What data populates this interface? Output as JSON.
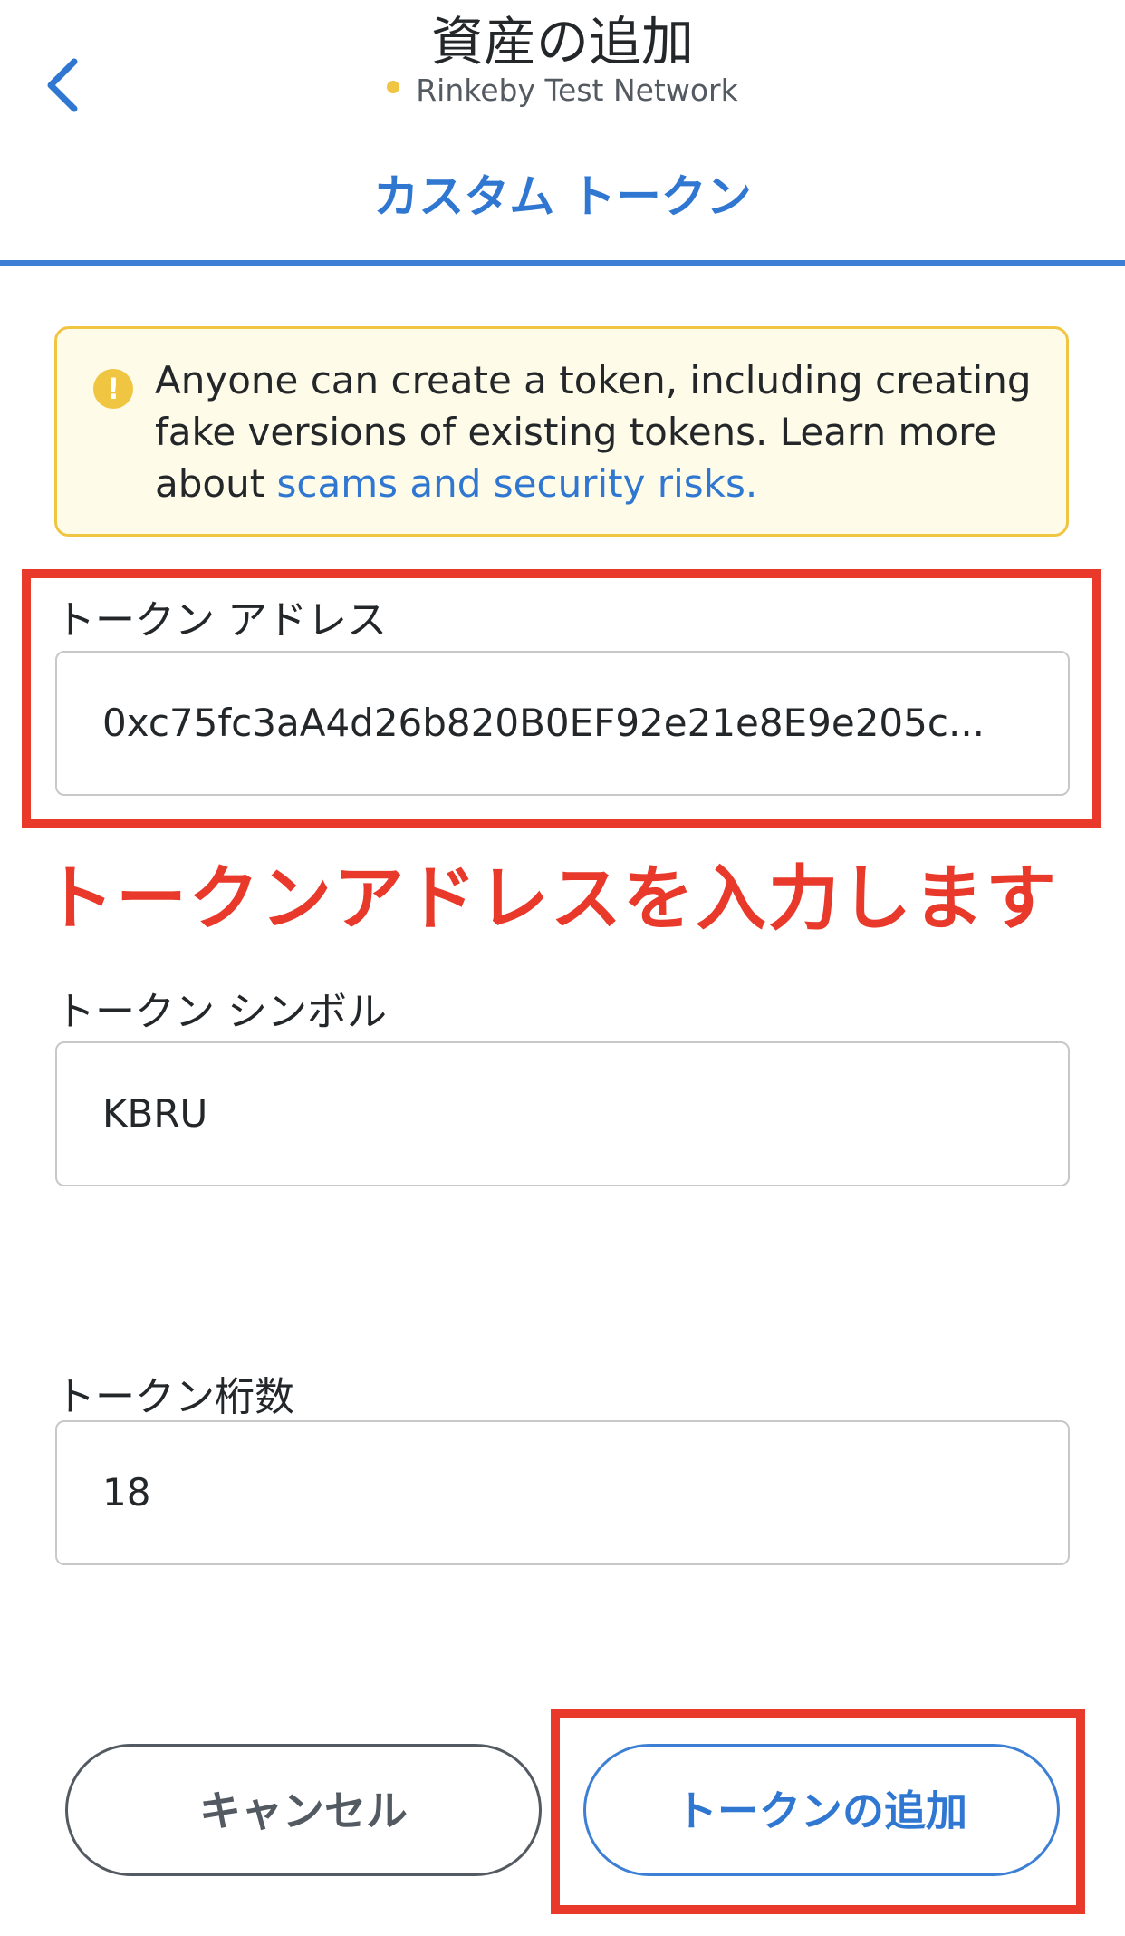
{
  "header": {
    "title": "資産の追加",
    "network": "Rinkeby Test Network",
    "back_icon": "chevron-left-icon"
  },
  "tab": {
    "label": "カスタム トークン"
  },
  "warning": {
    "text": "Anyone can create a token, including creating fake versions of existing tokens. Learn more about ",
    "link": "scams and security risks.",
    "icon": "exclamation-circle-icon",
    "icon_glyph": "!"
  },
  "fields": {
    "address": {
      "label": "トークン アドレス",
      "value": "0xc75fc3aA4d26b820B0EF92e21e8E9e205c..."
    },
    "symbol": {
      "label": "トークン シンボル",
      "value": "KBRU"
    },
    "decimals": {
      "label": "トークン桁数",
      "value": "18"
    }
  },
  "annotation": {
    "text": "トークンアドレスを入力します"
  },
  "buttons": {
    "cancel": "キャンセル",
    "add": "トークンの追加"
  },
  "colors": {
    "accent": "#2f77d1",
    "annotation_red": "#e8392a",
    "warning_border": "#f0c542",
    "warning_bg": "#fefbe8"
  }
}
